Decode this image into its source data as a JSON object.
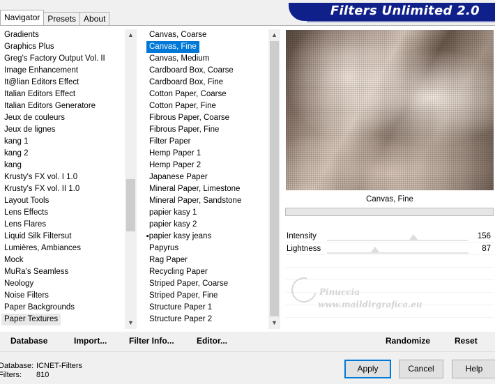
{
  "tabs": [
    "Navigator",
    "Presets",
    "About"
  ],
  "brand": {
    "title": "Filters Unlimited 2.0"
  },
  "categories": [
    "Gradients",
    "Graphics Plus",
    "Greg's Factory Output Vol. II",
    "Image Enhancement",
    "It@lian Editors Effect",
    "Italian Editors Effect",
    "Italian Editors Generatore",
    "Jeux de couleurs",
    "Jeux de lignes",
    "kang 1",
    "kang 2",
    "kang",
    "Krusty's FX vol. I 1.0",
    "Krusty's FX vol. II 1.0",
    "Layout Tools",
    "Lens Effects",
    "Lens Flares",
    "Liquid Silk Filtersut",
    "Lumières, Ambiances",
    "Mock",
    "MuRa's Seamless",
    "Neology",
    "Noise Filters",
    "Paper Backgrounds",
    "Paper Textures"
  ],
  "categories_selected": "Paper Textures",
  "filters": [
    "Canvas, Coarse",
    "Canvas, Fine",
    "Canvas, Medium",
    "Cardboard Box, Coarse",
    "Cardboard Box, Fine",
    "Cotton Paper, Coarse",
    "Cotton Paper, Fine",
    "Fibrous Paper, Coarse",
    "Fibrous Paper, Fine",
    "Filter Paper",
    "Hemp Paper 1",
    "Hemp Paper 2",
    "Japanese Paper",
    "Mineral Paper, Limestone",
    "Mineral Paper, Sandstone",
    "papier kasy 1",
    "papier kasy 2",
    "papier kasy jeans",
    "Papyrus",
    "Rag Paper",
    "Recycling Paper",
    "Striped Paper, Coarse",
    "Striped Paper, Fine",
    "Structure Paper 1",
    "Structure Paper 2"
  ],
  "filters_selected": "Canvas, Fine",
  "filters_marked": "papier kasy jeans",
  "filters_mark_glyph": "▪▪▪",
  "preview": {
    "caption": "Canvas, Fine",
    "progress": 0
  },
  "params": [
    {
      "label": "Intensity",
      "value": 156,
      "max": 255
    },
    {
      "label": "Lightness",
      "value": 87,
      "max": 255
    }
  ],
  "watermark": {
    "line1": "Pinuccia",
    "line2": "www.maildirgrafica.eu"
  },
  "commands": {
    "database": "Database",
    "import": "Import...",
    "filter_info": "Filter Info...",
    "editor": "Editor...",
    "randomize": "Randomize",
    "reset": "Reset"
  },
  "status": {
    "database_label": "Database:",
    "database_value": "ICNET-Filters",
    "filters_label": "Filters:",
    "filters_value": "810"
  },
  "buttons": {
    "apply": "Apply",
    "cancel": "Cancel",
    "help": "Help"
  },
  "icons": {
    "scroll_up": "▲",
    "scroll_down": "▼"
  }
}
